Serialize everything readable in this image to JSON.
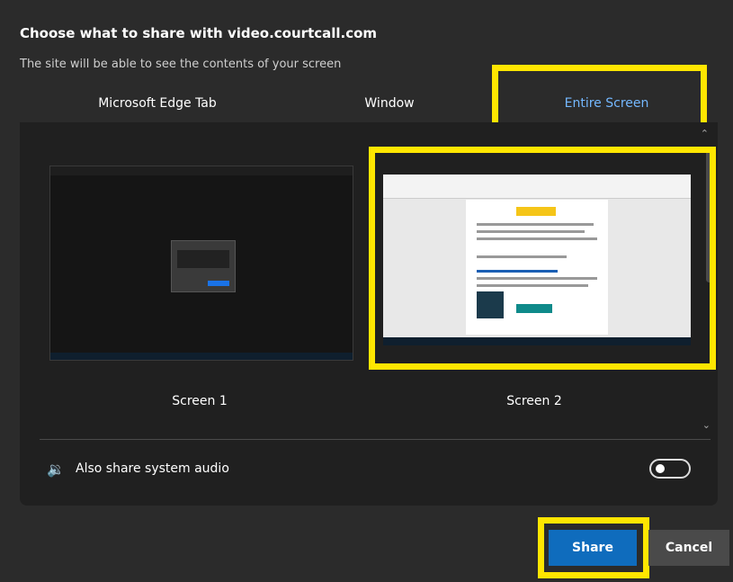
{
  "dialog": {
    "title": "Choose what to share with video.courtcall.com",
    "subtitle": "The site will be able to see the contents of your screen"
  },
  "tabs": [
    {
      "label": "Microsoft Edge Tab"
    },
    {
      "label": "Window"
    },
    {
      "label": "Entire Screen",
      "selected": true
    }
  ],
  "screens": [
    {
      "label": "Screen 1"
    },
    {
      "label": "Screen 2",
      "selected": true
    }
  ],
  "audio": {
    "label": "Also share system audio",
    "enabled": false
  },
  "buttons": {
    "share": "Share",
    "cancel": "Cancel"
  },
  "colors": {
    "accent": "#0f6cbd",
    "highlight": "#ffe600",
    "selected_tab": "#74b8ff"
  }
}
